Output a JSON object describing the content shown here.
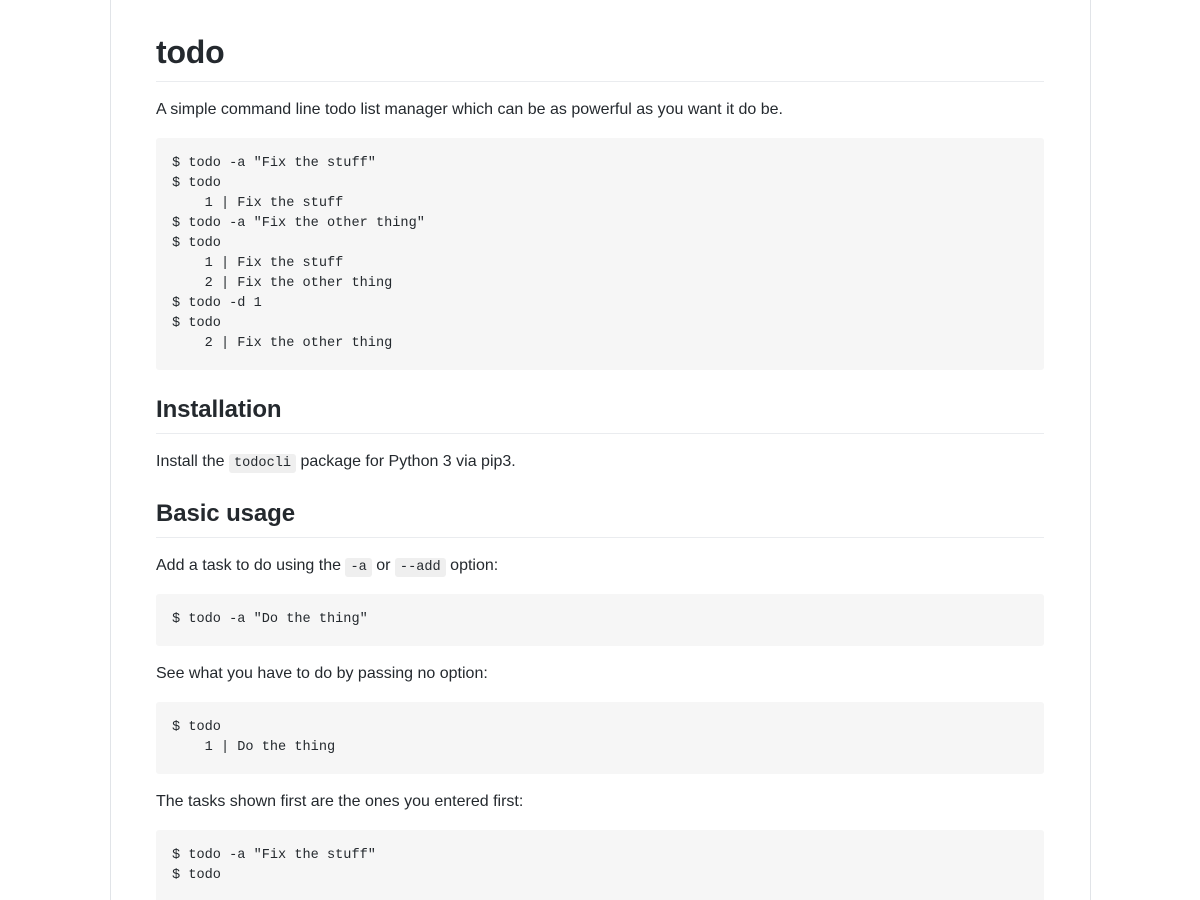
{
  "document": {
    "title": "todo",
    "intro": "A simple command line todo list manager which can be as powerful as you want it do be.",
    "demo_code": "$ todo -a \"Fix the stuff\"\n$ todo\n    1 | Fix the stuff\n$ todo -a \"Fix the other thing\"\n$ todo\n    1 | Fix the stuff\n    2 | Fix the other thing\n$ todo -d 1\n$ todo\n    2 | Fix the other thing",
    "sections": [
      {
        "heading": "Installation",
        "paragraph_prefix": "Install the ",
        "paragraph_code": "todocli",
        "paragraph_suffix": " package for Python 3 via pip3."
      },
      {
        "heading": "Basic usage",
        "add_prefix": "Add a task to do using the ",
        "add_code_1": "-a",
        "add_middle": " or ",
        "add_code_2": "--add",
        "add_suffix": " option:",
        "add_example": "$ todo -a \"Do the thing\"",
        "see_paragraph": "See what you have to do by passing no option:",
        "see_example": "$ todo\n    1 | Do the thing",
        "order_paragraph": "The tasks shown first are the ones you entered first:",
        "order_example": "$ todo -a \"Fix the stuff\"\n$ todo"
      }
    ]
  },
  "theme": {
    "text_color": "#24292e",
    "code_background": "#f6f6f6",
    "inline_code_background": "#efefef",
    "rule_color": "#e1e4e8",
    "heading_border_color": "#eaecef"
  }
}
